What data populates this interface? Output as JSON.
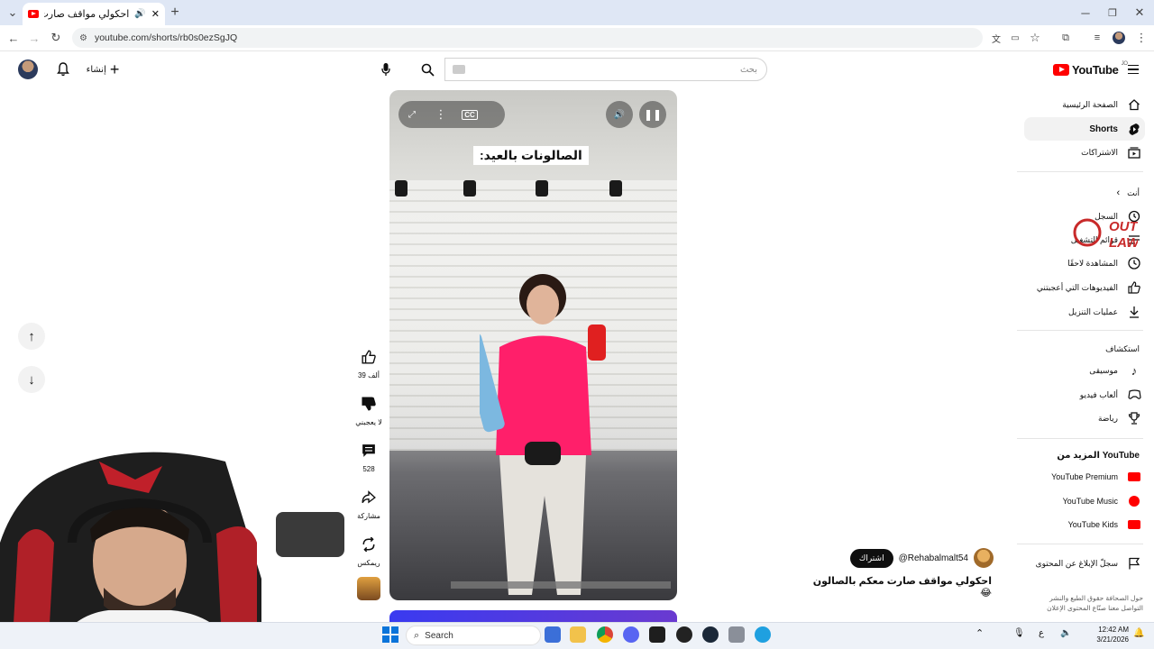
{
  "browser": {
    "tab_title": "احكولي مواقف صارت معكم",
    "new_tab_symbol": "+",
    "url": "youtube.com/shorts/rb0s0ezSgJQ"
  },
  "header": {
    "create_label": "إنشاء",
    "search_placeholder": "بحث",
    "logo_text": "YouTube",
    "logo_region": "JO"
  },
  "sidebar": {
    "top_items": [
      {
        "label": "الصفحة الرئيسية",
        "icon": "home-icon"
      },
      {
        "label": "Shorts",
        "icon": "shorts-icon",
        "active": true
      },
      {
        "label": "الاشتراكات",
        "icon": "subscriptions-icon"
      }
    ],
    "you_heading": "أنت",
    "you_items": [
      {
        "label": "السجل",
        "icon": "history-icon"
      },
      {
        "label": "قوائم التشغيل",
        "icon": "playlist-icon"
      },
      {
        "label": "المشاهدة لاحقًا",
        "icon": "watch-later-icon"
      },
      {
        "label": "الفيديوهات التي أعجبتني",
        "icon": "like-icon"
      },
      {
        "label": "عمليات التنزيل",
        "icon": "download-icon"
      }
    ],
    "explore_heading": "استكشاف",
    "explore_items": [
      {
        "label": "موسيقى",
        "icon": "music-icon"
      },
      {
        "label": "ألعاب فيديو",
        "icon": "gaming-icon"
      },
      {
        "label": "رياضة",
        "icon": "trophy-icon"
      }
    ],
    "more_heading": "المزيد من YouTube",
    "more_items": [
      {
        "label": "YouTube Premium",
        "icon": "youtube-premium-icon"
      },
      {
        "label": "YouTube Music",
        "icon": "youtube-music-icon"
      },
      {
        "label": "YouTube Kids",
        "icon": "youtube-kids-icon"
      }
    ],
    "report_label": "سجلّ الإبلاغ عن المحتوى",
    "footer_links": "حول الصحافة حقوق الطبع والنشر التواصل معنا صنّاع المحتوى الإعلان"
  },
  "video": {
    "caption": "الصالونات بالعيد:",
    "cc_label": "CC",
    "channel_handle": "@Rehabalmalt54",
    "subscribe_label": "اشتراك",
    "title": "احكولي مواقف صارت معكم بالصالون 😂"
  },
  "actions": {
    "likes": "39 ألف",
    "dislike_label": "لا يعجبني",
    "comments": "528",
    "share_label": "مشاركة",
    "remix_label": "ريمكس"
  },
  "watermark_text": "OUT LAW",
  "taskbar": {
    "search_label": "Search",
    "time": "12:42 AM",
    "date": "3/21/2026",
    "lang": "ع"
  },
  "colors": {
    "youtube_red": "#ff0000",
    "chrome_tabstrip": "#dfe7f5",
    "active_item_bg": "#f2f2f2"
  }
}
